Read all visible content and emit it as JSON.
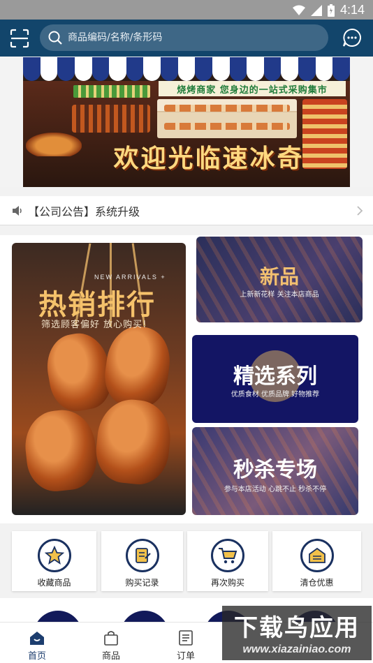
{
  "status_bar": {
    "time": "4:14",
    "icons": [
      "wifi-icon",
      "signal-icon",
      "battery-icon"
    ]
  },
  "header": {
    "search_placeholder": "商品编码/名称/条形码",
    "icons": [
      "scan-icon",
      "search-icon",
      "message-icon"
    ]
  },
  "banner": {
    "sign": "烧烤商家 您身边的一站式采购集市",
    "headline": "欢迎光临速冰奇"
  },
  "notice": {
    "text": "【公司公告】系统升级"
  },
  "features": {
    "hot": {
      "en": "NEW ARRIVALS +",
      "title": "热销排行",
      "subtitle": "筛选顾客偏好 放心购买!"
    },
    "new": {
      "title": "新品",
      "subtitle": "上新新花样 关注本店商品"
    },
    "selected": {
      "title": "精选系列",
      "subtitle": "优质食材 优质品牌 好物推荐"
    },
    "seckill": {
      "title": "秒杀专场",
      "subtitle": "参与本店活动 心跳不止 秒杀不停"
    }
  },
  "quick_links": [
    {
      "label": "收藏商品",
      "icon": "star-icon"
    },
    {
      "label": "购买记录",
      "icon": "record-icon"
    },
    {
      "label": "再次购买",
      "icon": "cart-icon"
    },
    {
      "label": "清仓优惠",
      "icon": "warehouse-icon"
    }
  ],
  "tabs": [
    {
      "label": "首页",
      "icon": "home-icon",
      "active": true
    },
    {
      "label": "商品",
      "icon": "bag-icon",
      "active": false
    },
    {
      "label": "订单",
      "icon": "order-icon",
      "active": false
    }
  ],
  "watermark": {
    "title": "下载鸟应用",
    "url": "www.xiazainiao.com"
  },
  "colors": {
    "header": "#12456b",
    "accent_navy": "#1c3d6e",
    "title_gold": "#f5c26b"
  }
}
